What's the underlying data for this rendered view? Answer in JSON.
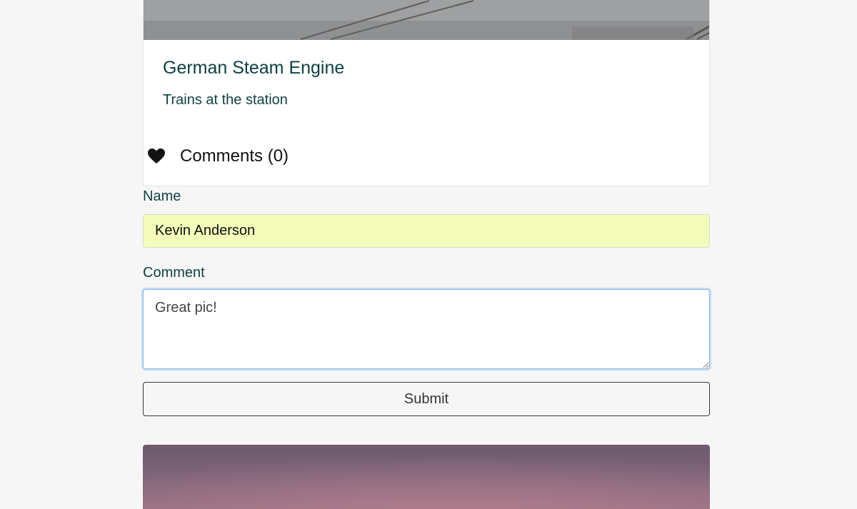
{
  "post": {
    "title": "German Steam Engine",
    "subtitle": "Trains at the station",
    "comments_label": "Comments (0)"
  },
  "form": {
    "name_label": "Name",
    "name_value": "Kevin Anderson",
    "comment_label": "Comment",
    "comment_value": "Great pic!",
    "submit_label": "Submit"
  },
  "icons": {
    "like": "heart-icon"
  },
  "colors": {
    "text_teal": "#0e3f42",
    "autofill_yellow": "#f3fcba",
    "focus_blue": "#8fb9e3",
    "page_bg": "#f6f6f6"
  }
}
